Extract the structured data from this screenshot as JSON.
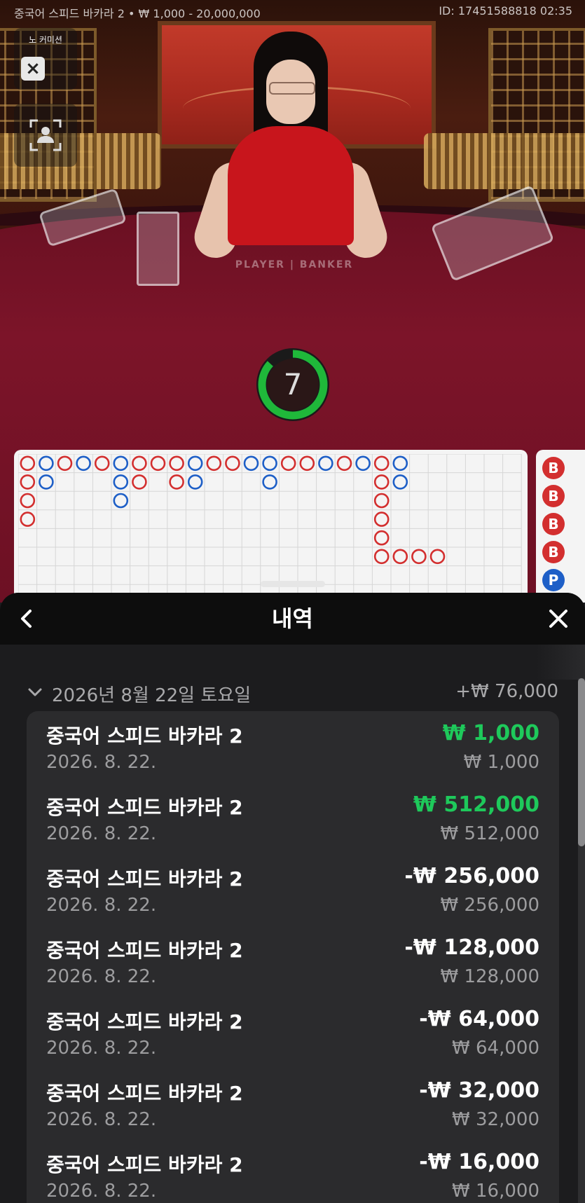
{
  "header": {
    "game_info": "중국어 스피드 바카라 2 • ₩ 1,000 - 20,000,000",
    "round_id": "ID: 17451588818 02:35"
  },
  "stage": {
    "commission_label": "노 커미션",
    "table_print": "PLAYER | BANKER",
    "timer_value": "7",
    "timer_color": "#1fb83a"
  },
  "colors": {
    "banker": "#d32f2f",
    "player": "#1e5fc7",
    "tie": "#2e9a3e",
    "win_amount": "#1ec95b"
  },
  "bead_road_side": [
    "B",
    "B",
    "B",
    "B",
    "P"
  ],
  "panel": {
    "title": "내역",
    "back_icon": "chevron-left-icon",
    "close_icon": "close-icon",
    "date_group": {
      "label": "2026년 8월 22일 토요일",
      "total": "+₩ 76,000"
    },
    "items": [
      {
        "name": "중국어 스피드 바카라 2",
        "date": "2026. 8. 22.",
        "amount": "₩ 1,000",
        "stake": "₩ 1,000",
        "positive": true
      },
      {
        "name": "중국어 스피드 바카라 2",
        "date": "2026. 8. 22.",
        "amount": "₩ 512,000",
        "stake": "₩ 512,000",
        "positive": true
      },
      {
        "name": "중국어 스피드 바카라 2",
        "date": "2026. 8. 22.",
        "amount": "-₩ 256,000",
        "stake": "₩ 256,000",
        "positive": false
      },
      {
        "name": "중국어 스피드 바카라 2",
        "date": "2026. 8. 22.",
        "amount": "-₩ 128,000",
        "stake": "₩ 128,000",
        "positive": false
      },
      {
        "name": "중국어 스피드 바카라 2",
        "date": "2026. 8. 22.",
        "amount": "-₩ 64,000",
        "stake": "₩ 64,000",
        "positive": false
      },
      {
        "name": "중국어 스피드 바카라 2",
        "date": "2026. 8. 22.",
        "amount": "-₩ 32,000",
        "stake": "₩ 32,000",
        "positive": false
      },
      {
        "name": "중국어 스피드 바카라 2",
        "date": "2026. 8. 22.",
        "amount": "-₩ 16,000",
        "stake": "₩ 16,000",
        "positive": false
      }
    ]
  }
}
